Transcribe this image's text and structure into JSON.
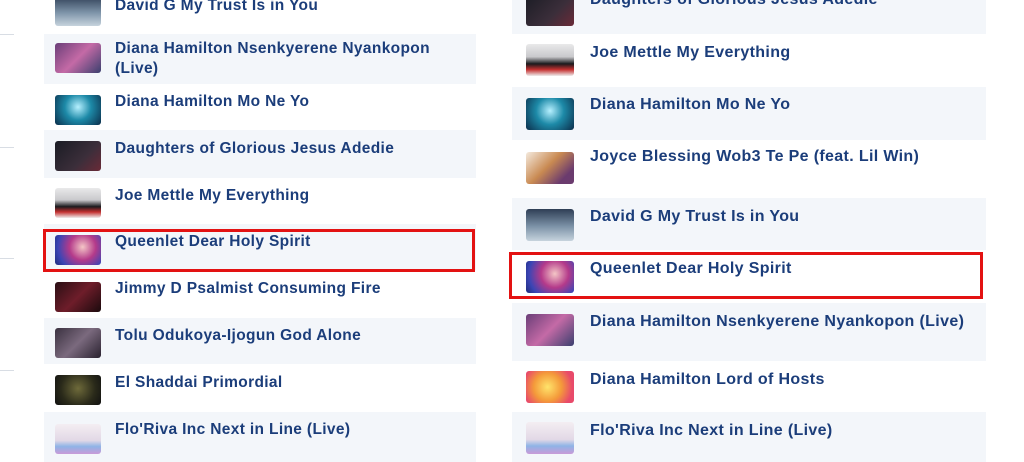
{
  "left_list": {
    "items": [
      {
        "title": "David G My Trust Is in You",
        "thumb": "david-g-cover"
      },
      {
        "title": "Diana Hamilton Nsenkyerene Nyankopon (Live)",
        "thumb": "diana-nsenkyerene-cover"
      },
      {
        "title": "Diana Hamilton Mo Ne Yo",
        "thumb": "diana-mo-ne-yo-cover"
      },
      {
        "title": "Daughters of Glorious Jesus Adedie",
        "thumb": "daughters-cover"
      },
      {
        "title": "Joe Mettle My Everything",
        "thumb": "joe-mettle-cover"
      },
      {
        "title": "Queenlet Dear Holy Spirit",
        "thumb": "queenlet-cover"
      },
      {
        "title": "Jimmy D Psalmist Consuming Fire",
        "thumb": "jimmy-d-cover"
      },
      {
        "title": "Tolu Odukoya-Ijogun God Alone",
        "thumb": "tolu-cover"
      },
      {
        "title": "El Shaddai Primordial",
        "thumb": "el-shaddai-cover"
      },
      {
        "title": "Flo'Riva Inc Next in Line (Live)",
        "thumb": "floriva-cover"
      }
    ]
  },
  "right_list": {
    "items": [
      {
        "title": "Daughters of Glorious Jesus Adedie",
        "thumb": "daughters-cover"
      },
      {
        "title": "Joe Mettle My Everything",
        "thumb": "joe-mettle-cover"
      },
      {
        "title": "Diana Hamilton Mo Ne Yo",
        "thumb": "diana-mo-ne-yo-cover"
      },
      {
        "title": "Joyce Blessing Wob3 Te Pe (feat. Lil Win)",
        "thumb": "joyce-blessing-cover"
      },
      {
        "title": "David G My Trust Is in You",
        "thumb": "david-g-cover"
      },
      {
        "title": "Queenlet Dear Holy Spirit",
        "thumb": "queenlet-cover"
      },
      {
        "title": "Diana Hamilton Nsenkyerene Nyankopon (Live)",
        "thumb": "diana-nsenkyerene-cover"
      },
      {
        "title": "Diana Hamilton Lord of Hosts",
        "thumb": "diana-lord-of-hosts-cover"
      },
      {
        "title": "Flo'Riva Inc Next in Line (Live)",
        "thumb": "floriva-cover"
      }
    ]
  },
  "highlighted_title": "Queenlet Dear Holy Spirit",
  "colors": {
    "title": "#1b3d7a",
    "row_alt": "#f3f6fa",
    "highlight": "#e31212"
  }
}
